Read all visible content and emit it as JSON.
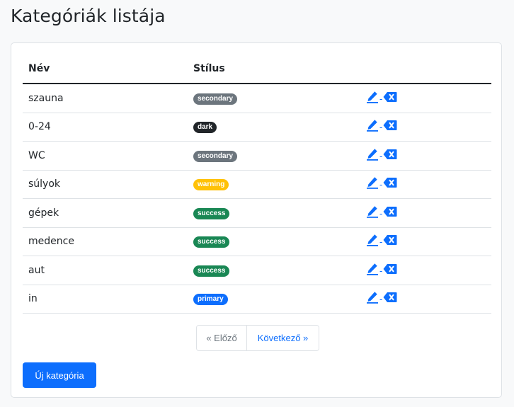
{
  "page": {
    "title": "Kategóriák listája"
  },
  "table": {
    "headers": {
      "name": "Név",
      "style": "Stílus"
    },
    "rows": [
      {
        "name": "szauna",
        "style": "secondary"
      },
      {
        "name": "0-24",
        "style": "dark"
      },
      {
        "name": "WC",
        "style": "secondary"
      },
      {
        "name": "súlyok",
        "style": "warning"
      },
      {
        "name": "gépek",
        "style": "success"
      },
      {
        "name": "medence",
        "style": "success"
      },
      {
        "name": "aut",
        "style": "success"
      },
      {
        "name": "in",
        "style": "primary"
      }
    ],
    "action_separator": "-"
  },
  "badge_colors": {
    "secondary": "#6c757d",
    "dark": "#212529",
    "warning": "#ffc107",
    "success": "#198754",
    "primary": "#0d6efd"
  },
  "icons": {
    "edit": "pencil-icon",
    "delete": "delete-icon"
  },
  "pagination": {
    "prev_label": "« Előző",
    "next_label": "Következő »"
  },
  "actions": {
    "new_label": "Új kategória"
  }
}
